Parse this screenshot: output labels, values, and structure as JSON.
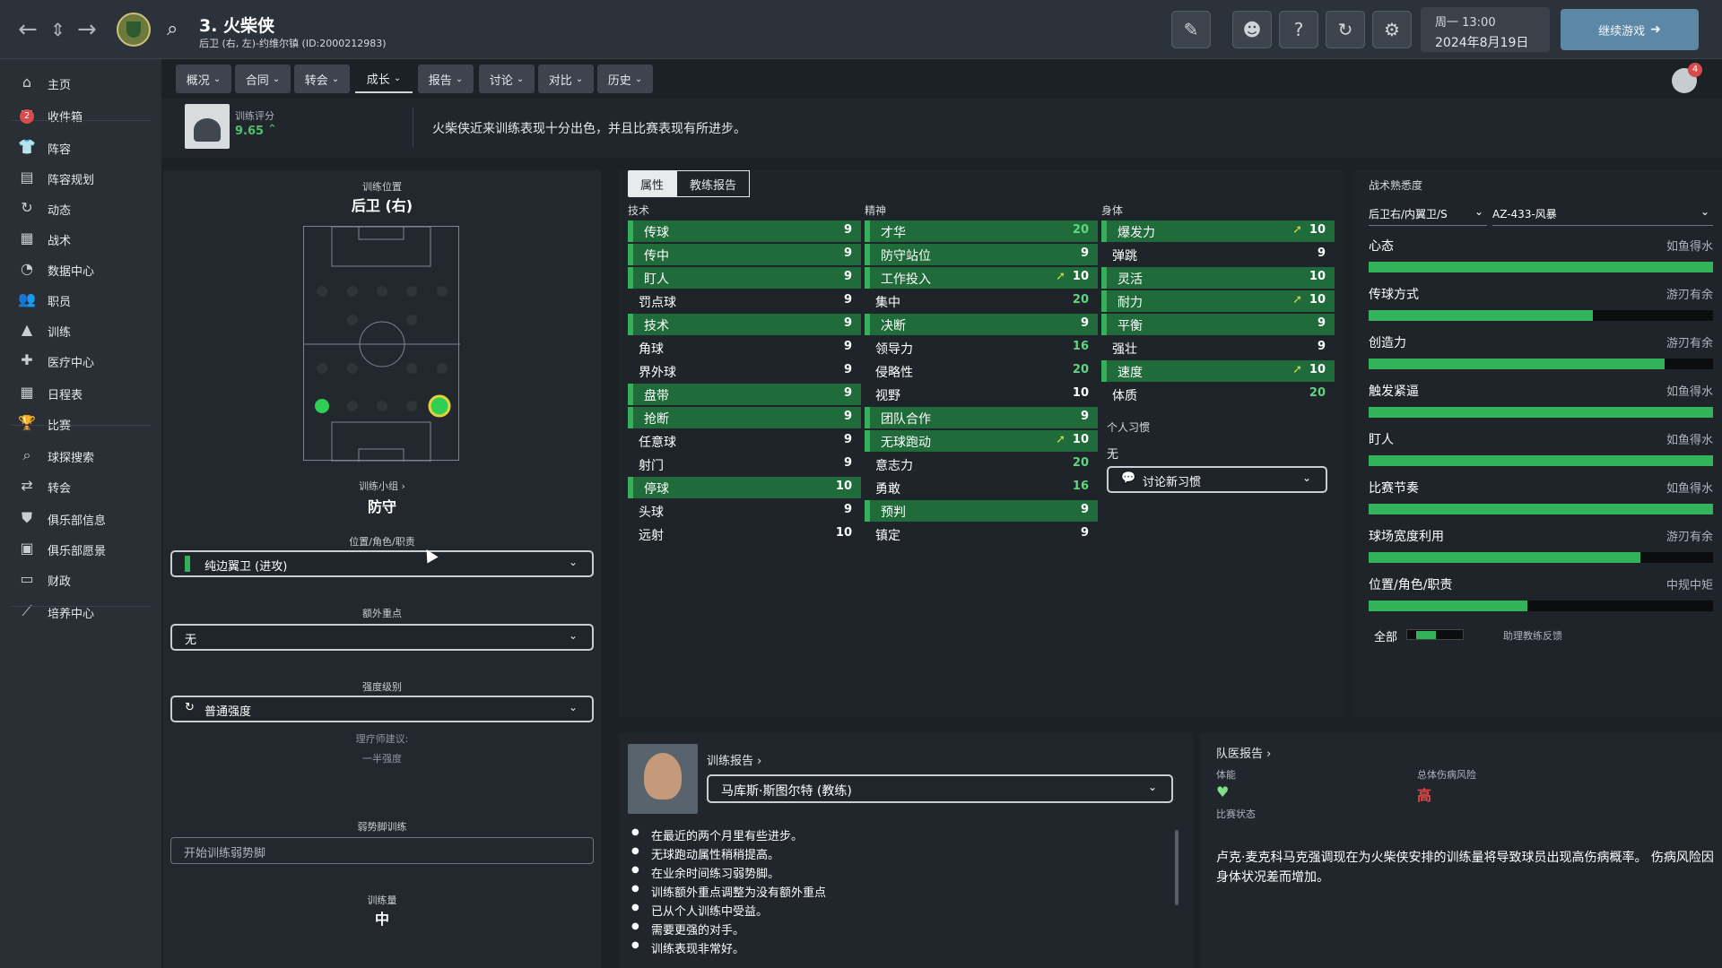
{
  "topbar": {
    "player_title": "3. 火柴侠",
    "player_sub": "后卫 (右, 左)-约维尔镇 (ID:2000212983)",
    "day_time": "周一 13:00",
    "date": "2024年8月19日",
    "continue_label": "继续游戏",
    "icons": [
      "back-icon",
      "up-down-icon",
      "forward-icon",
      "search-icon",
      "edit-icon",
      "coach-icon",
      "help-icon",
      "refresh-icon",
      "settings-icon"
    ]
  },
  "sidebar": {
    "items": [
      {
        "label": "主页",
        "icon": "home-icon",
        "glyph": "⌂"
      },
      {
        "label": "收件箱",
        "icon": "inbox-icon",
        "glyph": "✉"
      },
      {
        "label": "阵容",
        "icon": "shirt-icon",
        "glyph": "👕"
      },
      {
        "label": "阵容规划",
        "icon": "clipboard-icon",
        "glyph": "▤"
      },
      {
        "label": "动态",
        "icon": "dynamics-icon",
        "glyph": "↻"
      },
      {
        "label": "战术",
        "icon": "tactics-icon",
        "glyph": "▦"
      },
      {
        "label": "数据中心",
        "icon": "data-icon",
        "glyph": "◔"
      },
      {
        "label": "职员",
        "icon": "staff-icon",
        "glyph": "👥"
      },
      {
        "label": "训练",
        "icon": "training-icon",
        "glyph": "▲"
      },
      {
        "label": "医疗中心",
        "icon": "medical-icon",
        "glyph": "✚"
      },
      {
        "label": "日程表",
        "icon": "calendar-icon",
        "glyph": "▦"
      },
      {
        "label": "比赛",
        "icon": "trophy-icon",
        "glyph": "🏆"
      },
      {
        "label": "球探搜索",
        "icon": "scout-icon",
        "glyph": "⌕"
      },
      {
        "label": "转会",
        "icon": "transfer-icon",
        "glyph": "⇄"
      },
      {
        "label": "俱乐部信息",
        "icon": "club-info-icon",
        "glyph": "⛊"
      },
      {
        "label": "俱乐部愿景",
        "icon": "vision-icon",
        "glyph": "▣"
      },
      {
        "label": "财政",
        "icon": "finance-icon",
        "glyph": "▭"
      },
      {
        "label": "培养中心",
        "icon": "development-icon",
        "glyph": "⟋"
      }
    ],
    "inbox_badge": "2"
  },
  "subtabs": [
    "概况",
    "合同",
    "转会",
    "成长",
    "报告",
    "讨论",
    "对比",
    "历史"
  ],
  "notif_badge": "4",
  "rating": {
    "label": "训练评分",
    "value": "9.65",
    "summary": "火柴侠近来训练表现十分出色，并且比赛表现有所进步。"
  },
  "left": {
    "pos_label": "训练位置",
    "pos_value": "后卫 (右)",
    "group_label": "训练小组 ›",
    "group_value": "防守",
    "role_label": "位置/角色/职责",
    "role_value": "纯边翼卫 (进攻)",
    "focus_label": "额外重点",
    "focus_value": "无",
    "intensity_label": "强度级别",
    "intensity_value": "普通强度",
    "physio_label": "理疗师建议:",
    "physio_value": "一半强度",
    "weakfoot_label": "弱势脚训练",
    "weakfoot_button": "开始训练弱势脚",
    "load_label": "训练量",
    "load_value": "中"
  },
  "attributes": {
    "tab_attributes": "属性",
    "tab_coach_report": "教练报告",
    "technical_title": "技术",
    "mental_title": "精神",
    "physical_title": "身体",
    "technical": [
      {
        "name": "传球",
        "value": "9",
        "hl": true
      },
      {
        "name": "传中",
        "value": "9",
        "hl": true
      },
      {
        "name": "盯人",
        "value": "9",
        "hl": true
      },
      {
        "name": "罚点球",
        "value": "9",
        "hl": false
      },
      {
        "name": "技术",
        "value": "9",
        "hl": true
      },
      {
        "name": "角球",
        "value": "9",
        "hl": false
      },
      {
        "name": "界外球",
        "value": "9",
        "hl": false
      },
      {
        "name": "盘带",
        "value": "9",
        "hl": true
      },
      {
        "name": "抢断",
        "value": "9",
        "hl": true
      },
      {
        "name": "任意球",
        "value": "9",
        "hl": false
      },
      {
        "name": "射门",
        "value": "9",
        "hl": false
      },
      {
        "name": "停球",
        "value": "10",
        "hl": true
      },
      {
        "name": "头球",
        "value": "9",
        "hl": false
      },
      {
        "name": "远射",
        "value": "10",
        "hl": false
      }
    ],
    "mental": [
      {
        "name": "才华",
        "value": "20",
        "hl": true,
        "green": true
      },
      {
        "name": "防守站位",
        "value": "9",
        "hl": true
      },
      {
        "name": "工作投入",
        "value": "10",
        "hl": true,
        "up": true
      },
      {
        "name": "集中",
        "value": "20",
        "hl": false,
        "green": true
      },
      {
        "name": "决断",
        "value": "9",
        "hl": true
      },
      {
        "name": "领导力",
        "value": "16",
        "hl": false,
        "green": true
      },
      {
        "name": "侵略性",
        "value": "20",
        "hl": false,
        "green": true
      },
      {
        "name": "视野",
        "value": "10",
        "hl": false
      },
      {
        "name": "团队合作",
        "value": "9",
        "hl": true
      },
      {
        "name": "无球跑动",
        "value": "10",
        "hl": true,
        "up": true
      },
      {
        "name": "意志力",
        "value": "20",
        "hl": false,
        "green": true
      },
      {
        "name": "勇敢",
        "value": "16",
        "hl": false,
        "green": true
      },
      {
        "name": "预判",
        "value": "9",
        "hl": true
      },
      {
        "name": "镇定",
        "value": "9",
        "hl": false
      }
    ],
    "physical": [
      {
        "name": "爆发力",
        "value": "10",
        "hl": true,
        "up": true
      },
      {
        "name": "弹跳",
        "value": "9",
        "hl": false
      },
      {
        "name": "灵活",
        "value": "10",
        "hl": true
      },
      {
        "name": "耐力",
        "value": "10",
        "hl": true,
        "up": true
      },
      {
        "name": "平衡",
        "value": "9",
        "hl": true
      },
      {
        "name": "强壮",
        "value": "9",
        "hl": false
      },
      {
        "name": "速度",
        "value": "10",
        "hl": true,
        "up": true
      },
      {
        "name": "体质",
        "value": "20",
        "hl": false,
        "green": true
      }
    ],
    "habits_title": "个人习惯",
    "habits_value": "无",
    "discuss_habit": "讨论新习惯"
  },
  "tactical": {
    "title": "战术熟悉度",
    "role_select": "后卫右/内翼卫/S",
    "formation_select": "AZ-433-风暴",
    "rows": [
      {
        "name": "心态",
        "level": "如鱼得水",
        "fill": 1.0
      },
      {
        "name": "传球方式",
        "level": "游刃有余",
        "fill": 0.65
      },
      {
        "name": "创造力",
        "level": "游刃有余",
        "fill": 0.86
      },
      {
        "name": "触发紧逼",
        "level": "如鱼得水",
        "fill": 1.0
      },
      {
        "name": "盯人",
        "level": "如鱼得水",
        "fill": 1.0
      },
      {
        "name": "比赛节奏",
        "level": "如鱼得水",
        "fill": 1.0
      },
      {
        "name": "球场宽度利用",
        "level": "游刃有余",
        "fill": 0.79
      },
      {
        "name": "位置/角色/职责",
        "level": "中规中矩",
        "fill": 0.46
      }
    ],
    "all_label": "全部",
    "all_fill": 0.6,
    "assist_label": "助理教练反馈"
  },
  "coach_report": {
    "link": "训练报告 ›",
    "coach_select": "马库斯·斯图尔特 (教练)",
    "bullets": [
      "在最近的两个月里有些进步。",
      "无球跑动属性稍稍提高。",
      "在业余时间练习弱势脚。",
      "训练额外重点调整为没有额外重点",
      "已从个人训练中受益。",
      "需要更强的对手。",
      "训练表现非常好。"
    ]
  },
  "medical": {
    "link": "队医报告 ›",
    "fitness_label": "体能",
    "match_state_label": "比赛状态",
    "injury_label": "总体伤病风险",
    "injury_value": "高",
    "text": "卢克·麦克科马克强调现在为火柴侠安排的训练量将导致球员出现高伤病概率。 伤病风险因身体状况差而增加。"
  },
  "colors": {
    "accent_green": "#34b05a",
    "highlight_row": "#1f6b3a",
    "continue_btn": "#5c88a6",
    "danger": "#e04848"
  }
}
